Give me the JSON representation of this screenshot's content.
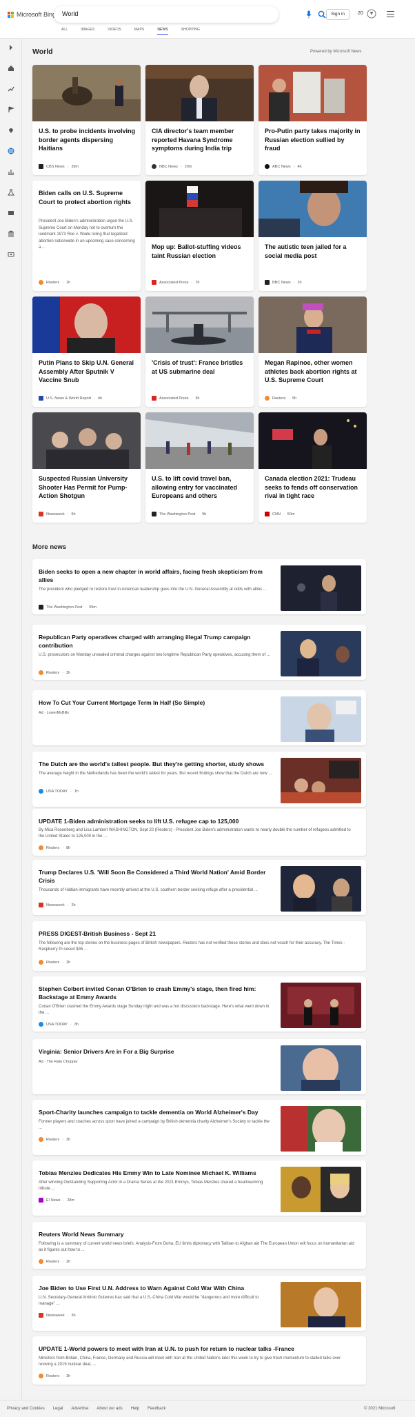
{
  "header": {
    "logo_text": "Microsoft Bing",
    "search_value": "World",
    "signin_label": "Sign in",
    "rewards_count": "20",
    "tabs": [
      {
        "label": "ALL"
      },
      {
        "label": "IMAGES"
      },
      {
        "label": "VIDEOS"
      },
      {
        "label": "MAPS"
      },
      {
        "label": "NEWS"
      },
      {
        "label": "SHOPPING"
      }
    ],
    "active_tab": "NEWS"
  },
  "world": {
    "title": "World",
    "powered_by": "Powered by Microsoft News",
    "cards": [
      {
        "title": "U.S. to probe incidents involving border agents dispersing Haitians",
        "source": "CBS News",
        "time": "39m",
        "logo_color": "#222"
      },
      {
        "title": "CIA director's team member reported Havana Syndrome symptoms during India trip",
        "source": "NBC News",
        "time": "20m",
        "logo_color": "#333"
      },
      {
        "title": "Pro-Putin party takes majority in Russian election sullied by fraud",
        "source": "ABC News",
        "time": "4h",
        "logo_color": "#111"
      },
      {
        "title": "Biden calls on U.S. Supreme Court to protect abortion rights",
        "snippet": "President Joe Biden's administration urged the U.S. Supreme Court on Monday not to overturn the landmark 1973 Roe v. Wade ruling that legalized abortion nationwide in an upcoming case concerning a ...",
        "source": "Reuters",
        "time": "1h",
        "logo_color": "#f28b2c"
      },
      {
        "title": "Mop up: Ballot-stuffing videos taint Russian election",
        "source": "Associated Press",
        "time": "7h",
        "logo_color": "#d22"
      },
      {
        "title": "The autistic teen jailed for a social media post",
        "source": "BBC News",
        "time": "2h",
        "logo_color": "#222"
      },
      {
        "title": "Putin Plans to Skip U.N. General Assembly After Sputnik V Vaccine Snub",
        "source": "U.S. News & World Report",
        "time": "4h",
        "logo_color": "#2a4aa8"
      },
      {
        "title": "'Crisis of trust': France bristles at US submarine deal",
        "source": "Associated Press",
        "time": "3h",
        "logo_color": "#d22"
      },
      {
        "title": "Megan Rapinoe, other women athletes back abortion rights at U.S. Supreme Court",
        "source": "Reuters",
        "time": "5h",
        "logo_color": "#f28b2c"
      },
      {
        "title": "Suspected Russian University Shooter Has Permit for Pump-Action Shotgun",
        "source": "Newsweek",
        "time": "5h",
        "logo_color": "#d32"
      },
      {
        "title": "U.S. to lift covid travel ban, allowing entry for vaccinated Europeans and others",
        "source": "The Washington Post",
        "time": "9h",
        "logo_color": "#222"
      },
      {
        "title": "Canada election 2021: Trudeau seeks to fends off conservation rival in tight race",
        "source": "CNN",
        "time": "50m",
        "logo_color": "#c00"
      }
    ]
  },
  "more_news": {
    "title": "More news",
    "items": [
      {
        "title": "Biden seeks to open a new chapter in world affairs, facing fresh skepticism from allies",
        "snippet": "The president who pledged to restore trust in American leadership goes into the U.N. General Assembly at odds with allies ...",
        "source": "The Washington Post",
        "time": "59m",
        "logo_color": "#222"
      },
      {
        "title": "Republican Party operatives charged with arranging illegal Trump campaign contribution",
        "snippet": "U.S. prosecutors on Monday unsealed criminal charges against two longtime Republican Party operatives, accusing them of ...",
        "source": "Reuters",
        "time": "2h",
        "logo_color": "#f28b2c"
      },
      {
        "title": "How To Cut Your Current Mortgage Term In Half (So Simple)",
        "snippet": "",
        "source": "Ad · LowerMyBills",
        "time": "",
        "logo_color": ""
      },
      {
        "title": "The Dutch are the world's tallest people. But they're getting shorter, study shows",
        "snippet": "The average height in the Netherlands has been the world's tallest for years. But recent findings show that the Dutch are now ...",
        "source": "USA TODAY",
        "time": "1h",
        "logo_color": "#1a8ae6"
      },
      {
        "title": "UPDATE 1-Biden administration seeks to lift U.S. refugee cap to 125,000",
        "snippet": "By Mica Rosenberg and Lisa Lambert WASHINGTON, Sept 20 (Reuters) - President Joe Biden's administration wants to nearly double the number of refugees admitted to the United States to 125,000 in the ...",
        "source": "Reuters",
        "time": "8h",
        "logo_color": "#f28b2c"
      },
      {
        "title": "Trump Declares U.S. 'Will Soon Be Considered a Third World Nation' Amid Border Crisis",
        "snippet": "Thousands of Haitian immigrants have recently arrived at the U.S. southern border seeking refuge after a presidential ...",
        "source": "Newsweek",
        "time": "2h",
        "logo_color": "#d32"
      },
      {
        "title": "PRESS DIGEST-British Business - Sept 21",
        "snippet": "The following are the top stories on the business pages of British newspapers. Reuters has not verified these stories and does not vouch for their accuracy. The Times - Raspberry Pi raised $45 ...",
        "source": "Reuters",
        "time": "2h",
        "logo_color": "#f28b2c"
      },
      {
        "title": "Stephen Colbert invited Conan O'Brien to crash Emmy's stage, then fired him: Backstage at Emmy Awards",
        "snippet": "Conan O'Brien crashed the Emmy Awards stage Sunday night and was a hot discussion backstage. Here's what went down in the ...",
        "source": "USA TODAY",
        "time": "3h",
        "logo_color": "#1a8ae6"
      },
      {
        "title": "Virginia: Senior Drivers Are in For a Big Surprise",
        "snippet": "",
        "source": "Ad · The Rate Chopper",
        "time": "",
        "logo_color": ""
      },
      {
        "title": "Sport-Charity launches campaign to tackle dementia on World Alzheimer's Day",
        "snippet": "Former players and coaches across sport have joined a campaign by British dementia charity Alzheimer's Society to tackle the ...",
        "source": "Reuters",
        "time": "3h",
        "logo_color": "#f28b2c"
      },
      {
        "title": "Tobias Menzies Dedicates His Emmy Win to Late Nominee Michael K. Williams",
        "snippet": "After winning Outstanding Supporting Actor in a Drama Series at the 2021 Emmys, Tobias Menzies shared a heartwarming tribute ...",
        "source": "E! News",
        "time": "28m",
        "logo_color": "#a0c"
      },
      {
        "title": "Reuters World News Summary",
        "snippet": "Following is a summary of current world news briefs. Analysis-From Doha, EU limits diplomacy with Taliban to Afghan aid The European Union will focus on humanitarian aid as it figures out how to ...",
        "source": "Reuters",
        "time": "2h",
        "logo_color": "#f28b2c"
      },
      {
        "title": "Joe Biden to Use First U.N. Address to Warn Against Cold War With China",
        "snippet": "U.N. Secretary-General António Guterres has said that a U.S.-China Cold War would be \"dangerous and more difficult to manage\" ...",
        "source": "Newsweek",
        "time": "3h",
        "logo_color": "#d32"
      },
      {
        "title": "UPDATE 1-World powers to meet with Iran at U.N. to push for return to nuclear talks -France",
        "snippet": "Ministers from Britain, China, France, Germany and Russia will meet with Iran at the United Nations later this week to try to give fresh momentum to stalled talks over reviving a 2015 nuclear deal, ...",
        "source": "Reuters",
        "time": "3h",
        "logo_color": "#f28b2c"
      }
    ]
  },
  "footer": {
    "links": [
      "Privacy and Cookies",
      "Legal",
      "Advertise",
      "About our ads",
      "Help",
      "Feedback"
    ],
    "copyright": "© 2021 Microsoft"
  }
}
